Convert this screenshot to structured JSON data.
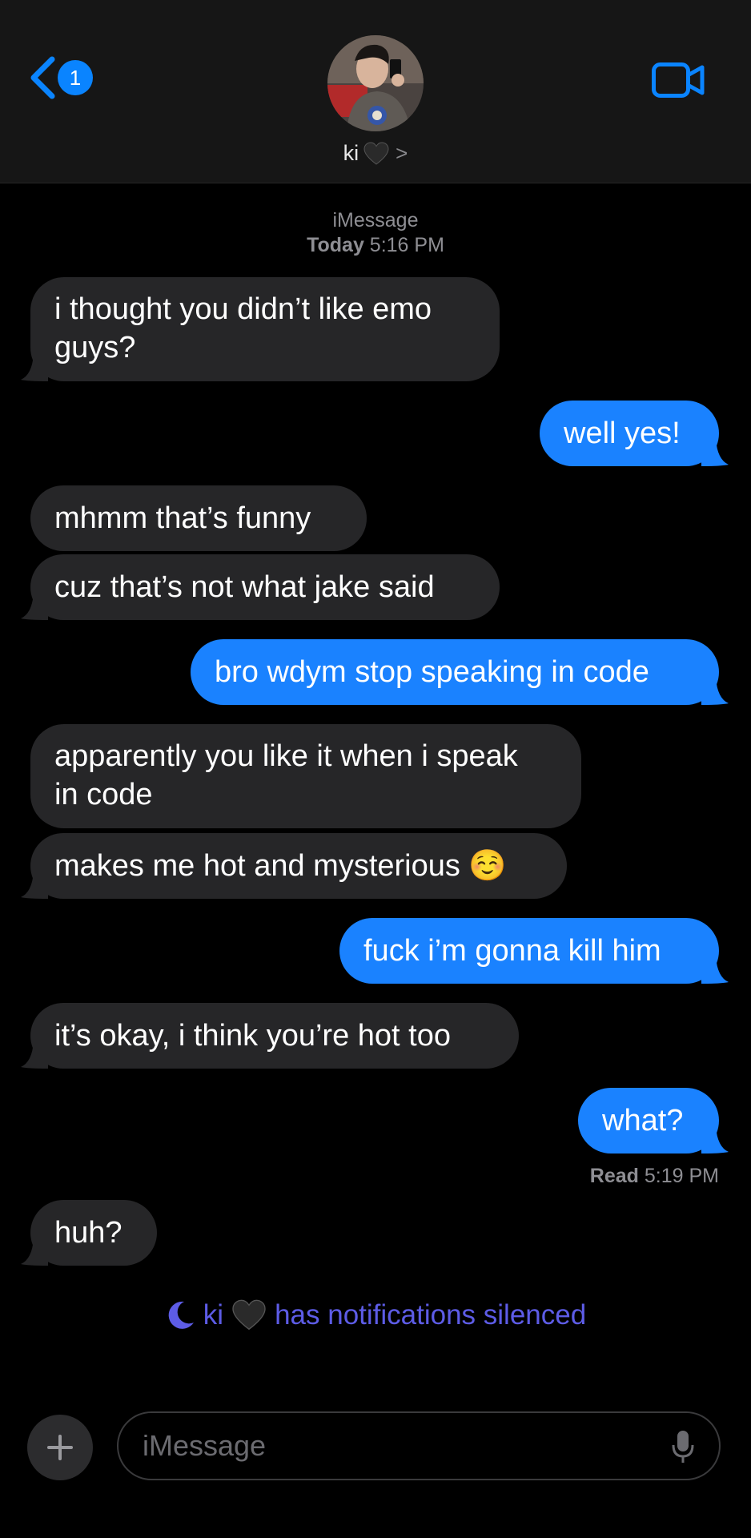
{
  "header": {
    "back_badge": "1",
    "contact_name": "ki",
    "contact_emoji": "black-heart",
    "chevron": ">"
  },
  "thread_meta": {
    "service": "iMessage",
    "day": "Today",
    "time": "5:16 PM"
  },
  "messages": [
    {
      "from": "them",
      "text_lines": [
        "i thought you didn’t like emo",
        "guys?"
      ]
    },
    {
      "from": "me",
      "text": "well yes!"
    },
    {
      "from": "them",
      "text": "mhmm that’s funny"
    },
    {
      "from": "them",
      "text": "cuz that’s not what jake said"
    },
    {
      "from": "me",
      "text": "bro wdym stop speaking in code"
    },
    {
      "from": "them",
      "text_lines": [
        "apparently you like it when i speak",
        "in code"
      ]
    },
    {
      "from": "them",
      "text": "makes me hot and mysterious ☺️"
    },
    {
      "from": "me",
      "text": "fuck i’m gonna kill him"
    },
    {
      "from": "them",
      "text": "it’s okay, i think you’re hot too"
    },
    {
      "from": "me",
      "text": "what?"
    },
    {
      "from": "them",
      "text": "huh?"
    }
  ],
  "read_receipt": {
    "label": "Read",
    "time": "5:19 PM"
  },
  "silenced_notice": {
    "name": "ki",
    "text": "has notifications silenced"
  },
  "composer": {
    "placeholder": "iMessage"
  },
  "colors": {
    "incoming_bubble": "#262628",
    "outgoing_bubble": "#1a82ff",
    "accent": "#0a84ff",
    "focus_purple": "#5d5ce6"
  }
}
